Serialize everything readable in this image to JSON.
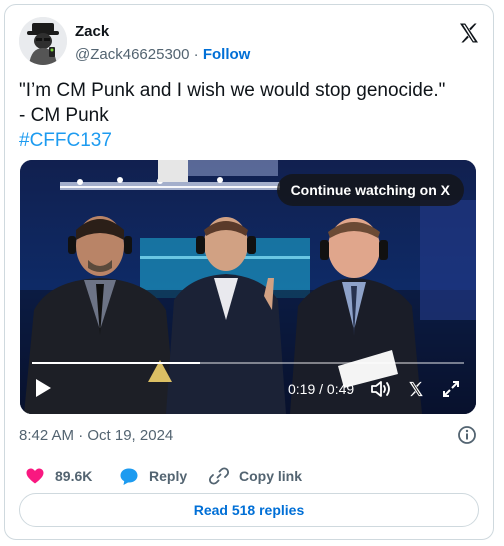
{
  "author": {
    "name": "Zack",
    "handle": "@Zack46625300",
    "separator": "·",
    "follow_label": "Follow"
  },
  "tweet": {
    "line1": "\"I’m CM Punk and I wish we would stop genocide.\"",
    "line2": "- CM Punk",
    "hashtag": "#CFFC137"
  },
  "video": {
    "continue_label": "Continue watching on X",
    "time_current": "0:19",
    "time_sep": " / ",
    "time_total": "0:49",
    "progress": 0.388
  },
  "meta": {
    "timestamp": "8:42 AM · Oct 19, 2024"
  },
  "actions": {
    "likes": "89.6K",
    "reply_label": "Reply",
    "copy_link_label": "Copy link"
  },
  "read_replies_label": "Read 518 replies",
  "icons": [
    "x-logo-icon",
    "play-icon",
    "volume-icon",
    "x-watermark-icon",
    "fullscreen-icon",
    "info-icon",
    "heart-icon",
    "reply-bubble-icon",
    "link-icon"
  ],
  "colors": {
    "link": "#006fd6",
    "hashtag": "#1d9bf0",
    "heart": "#f91880",
    "reply": "#1d9bf0",
    "muted": "#536471"
  }
}
